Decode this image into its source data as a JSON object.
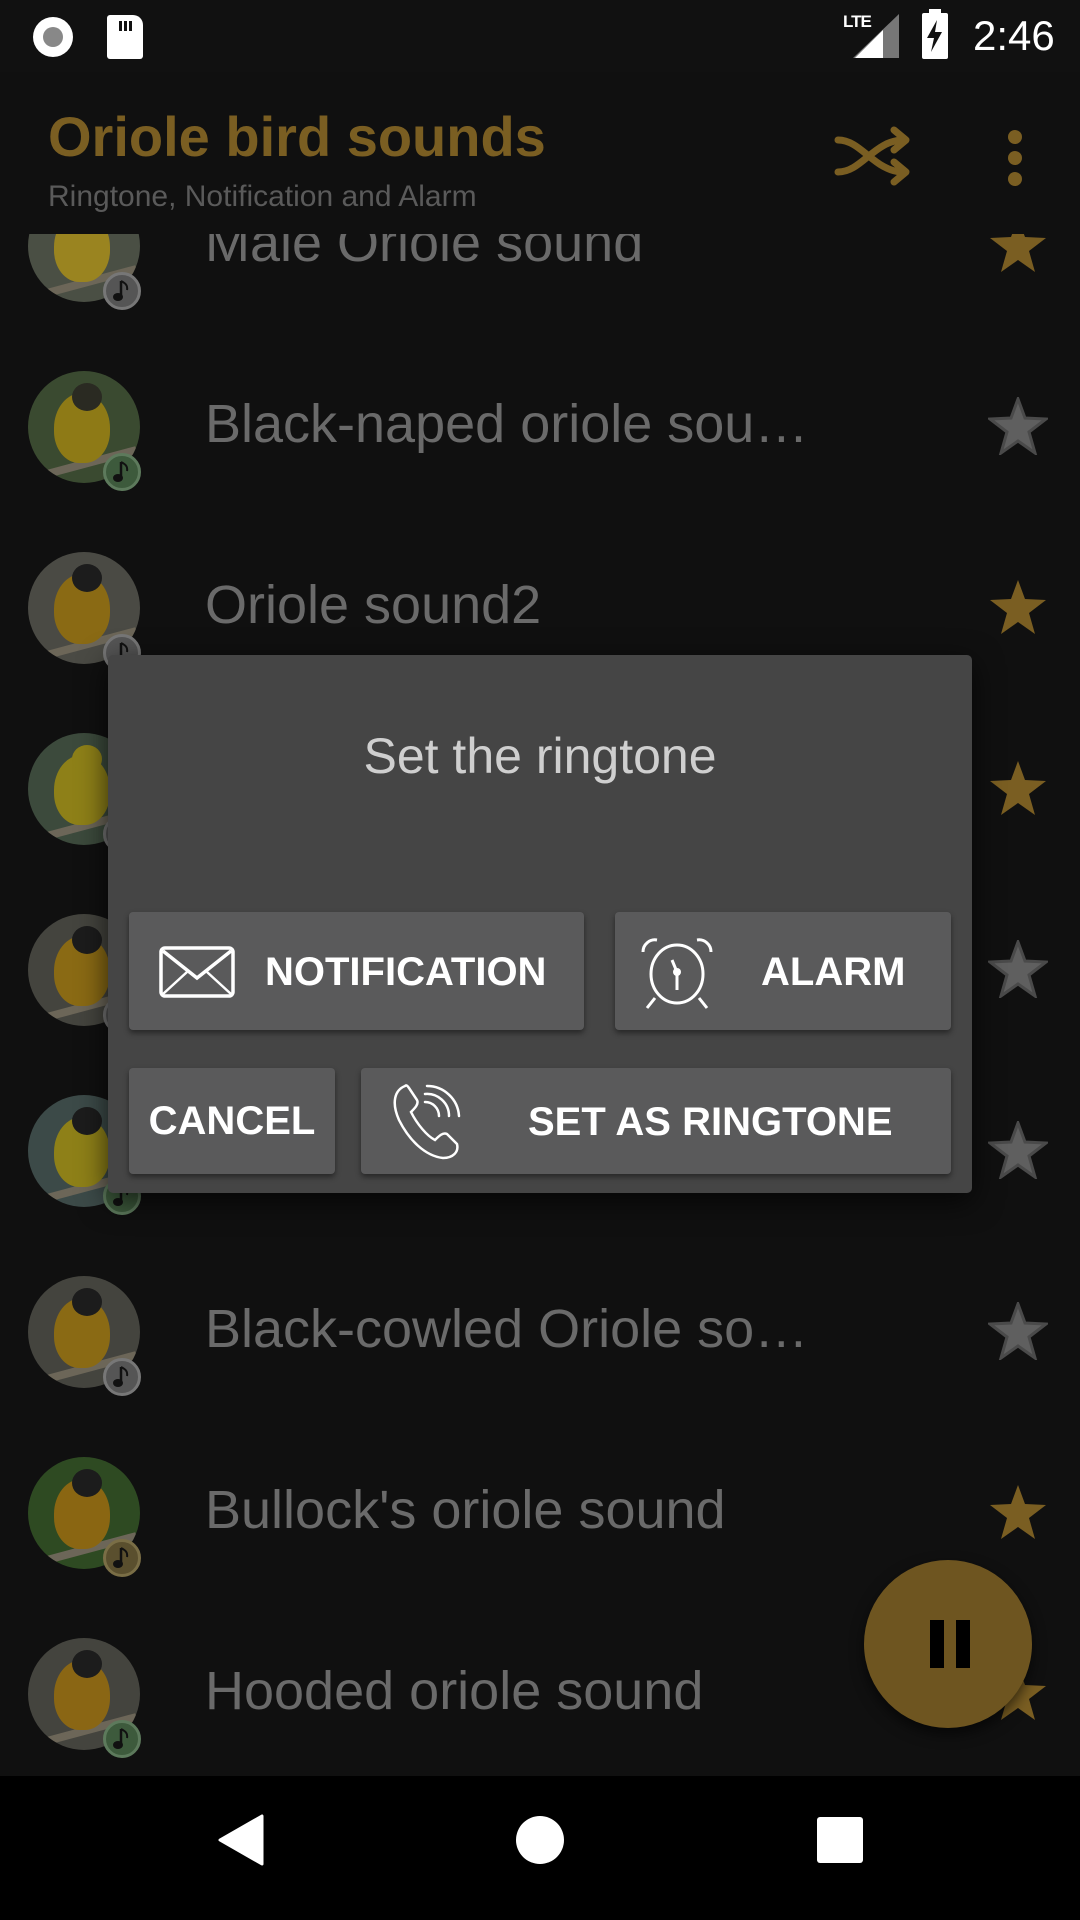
{
  "status_bar": {
    "time": "2:46",
    "network": "LTE",
    "icons": [
      "screen-record-icon",
      "sd-card-icon",
      "lte-signal-icon",
      "battery-charging-icon"
    ]
  },
  "app_bar": {
    "title": "Oriole bird sounds",
    "subtitle": "Ringtone, Notification and Alarm",
    "actions": [
      "shuffle-icon",
      "more-vert-icon"
    ]
  },
  "colors": {
    "accent": "#7a5e22",
    "star_active": "#7a5e22",
    "star_inactive": "#5f5f5f",
    "dialog_bg": "#454545",
    "button_bg": "#5a5a5b"
  },
  "sounds": [
    {
      "title": "Male Oriole sound",
      "favorite": true,
      "badge": "grey"
    },
    {
      "title": "Black-naped oriole sou…",
      "favorite": false,
      "badge": "green"
    },
    {
      "title": "Oriole sound2",
      "favorite": true,
      "badge": "grey"
    },
    {
      "title": "",
      "favorite": true,
      "badge": "grey"
    },
    {
      "title": "",
      "favorite": false,
      "badge": "grey"
    },
    {
      "title": "",
      "favorite": false,
      "badge": "green"
    },
    {
      "title": "Black-cowled Oriole so…",
      "favorite": false,
      "badge": "grey"
    },
    {
      "title": "Bullock's oriole sound",
      "favorite": true,
      "badge": "gold"
    },
    {
      "title": "Hooded oriole sound",
      "favorite": true,
      "badge": "green"
    }
  ],
  "dialog": {
    "title": "Set the ringtone",
    "buttons": {
      "notification": "NOTIFICATION",
      "alarm": "ALARM",
      "cancel": "CANCEL",
      "set_ringtone": "SET AS RINGTONE"
    }
  },
  "player": {
    "state": "playing",
    "fab_icon": "pause-icon"
  },
  "nav_bar": {
    "buttons": [
      "back-icon",
      "home-icon",
      "recents-icon"
    ]
  }
}
